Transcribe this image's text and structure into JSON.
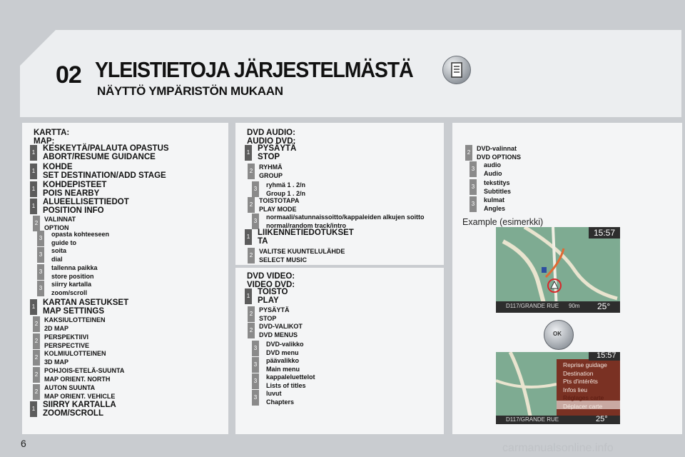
{
  "chapter": "02",
  "title": "YLEISTIETOJA JÄRJESTELMÄSTÄ",
  "subtitle": "NÄYTTÖ YMPÄRISTÖN MUKAAN",
  "page_number": "6",
  "watermark": "carmanualsonline.info",
  "icons": {
    "header": "document-icon",
    "joystick": "joystick-ok-icon"
  },
  "col1": {
    "heading": [
      "KARTTA:",
      "MAP:"
    ],
    "items": [
      {
        "level": "1",
        "lines": [
          "KESKEYTÄ/PALAUTA OPASTUS",
          "ABORT/RESUME GUIDANCE"
        ]
      },
      {
        "level": "1",
        "lines": [
          "KOHDE",
          "SET DESTINATION/ADD STAGE"
        ]
      },
      {
        "level": "1",
        "lines": [
          "KOHDEPISTEET",
          "POIS NEARBY"
        ]
      },
      {
        "level": "1",
        "lines": [
          "ALUEELLISETTIEDOT",
          "POSITION INFO"
        ]
      },
      {
        "level": "2",
        "lines": [
          "VALINNAT",
          "OPTION"
        ]
      },
      {
        "level": "3",
        "lines": [
          "opasta kohteeseen",
          "guide to"
        ]
      },
      {
        "level": "3",
        "lines": [
          "soita",
          "dial"
        ]
      },
      {
        "level": "3",
        "lines": [
          "tallenna paikka",
          "store position"
        ]
      },
      {
        "level": "3",
        "lines": [
          "siirry kartalla",
          "zoom/scroll"
        ]
      },
      {
        "level": "1",
        "lines": [
          "KARTAN ASETUKSET",
          "MAP SETTINGS"
        ]
      },
      {
        "level": "2",
        "lines": [
          "KAKSIULOTTEINEN",
          "2D MAP"
        ]
      },
      {
        "level": "2",
        "lines": [
          "PERSPEKTIIVI",
          "PERSPECTIVE"
        ]
      },
      {
        "level": "2",
        "lines": [
          "KOLMIULOTTEINEN",
          "3D MAP"
        ]
      },
      {
        "level": "2",
        "lines": [
          "POHJOIS-ETELÄ-SUUNTA",
          "MAP ORIENT. NORTH"
        ]
      },
      {
        "level": "2",
        "lines": [
          "AUTON SUUNTA",
          "MAP ORIENT. VEHICLE"
        ]
      },
      {
        "level": "1",
        "lines": [
          "SIIRRY KARTALLA",
          "ZOOM/SCROLL"
        ]
      }
    ]
  },
  "col2a": {
    "heading": [
      "DVD AUDIO:",
      "AUDIO DVD:"
    ],
    "items": [
      {
        "level": "1",
        "lines": [
          "PYSÄYTÄ",
          "STOP"
        ]
      },
      {
        "level": "2",
        "lines": [
          "RYHMÄ",
          "GROUP"
        ]
      },
      {
        "level": "3",
        "lines": [
          "ryhmä 1 . 2/n",
          "Group 1 . 2/n"
        ]
      },
      {
        "level": "2",
        "lines": [
          "TOISTOTAPA",
          "PLAY MODE"
        ]
      },
      {
        "level": "3",
        "lines": [
          "normaali/satunnaissoitto/kappaleiden alkujen soitto",
          "normal/random track/intro"
        ]
      },
      {
        "level": "1",
        "lines": [
          "LIIKENNETIEDOTUKSET",
          "TA"
        ]
      },
      {
        "level": "2",
        "lines": [
          "VALITSE KUUNTELULÄHDE",
          "SELECT MUSIC"
        ]
      }
    ]
  },
  "col2b": {
    "heading": [
      "DVD VIDEO:",
      "VIDEO DVD:"
    ],
    "items": [
      {
        "level": "1",
        "lines": [
          "TOISTO",
          "PLAY"
        ]
      },
      {
        "level": "2",
        "lines": [
          "PYSÄYTÄ",
          "STOP"
        ]
      },
      {
        "level": "2",
        "lines": [
          "DVD-VALIKOT",
          "DVD MENUS"
        ]
      },
      {
        "level": "3",
        "lines": [
          "DVD-valikko",
          "DVD menu"
        ]
      },
      {
        "level": "3",
        "lines": [
          "päävalikko",
          "Main menu"
        ]
      },
      {
        "level": "3",
        "lines": [
          "kappaleluettelot",
          "Lists of titles"
        ]
      },
      {
        "level": "3",
        "lines": [
          "luvut",
          "Chapters"
        ]
      }
    ]
  },
  "col3": {
    "items": [
      {
        "level": "2",
        "lines": [
          "DVD-valinnat",
          "DVD OPTIONS"
        ]
      },
      {
        "level": "3",
        "lines": [
          "audio",
          "Audio"
        ]
      },
      {
        "level": "3",
        "lines": [
          "tekstitys",
          "Subtitles"
        ]
      },
      {
        "level": "3",
        "lines": [
          "kulmat",
          "Angles"
        ]
      }
    ],
    "example_label": "Example (esimerkki)"
  },
  "screen1": {
    "time": "15:57",
    "road": "D117/GRANDE RUE",
    "distance": "90m",
    "temp": "25°"
  },
  "screen2": {
    "time": "15:57",
    "road": "D117/GRANDE RUE",
    "temp": "25°",
    "menu": [
      "Reprise guidage",
      "Destination",
      "Pts d'intérêts",
      "Infos lieu",
      "Réglages carte",
      "Déplacer carte"
    ]
  }
}
